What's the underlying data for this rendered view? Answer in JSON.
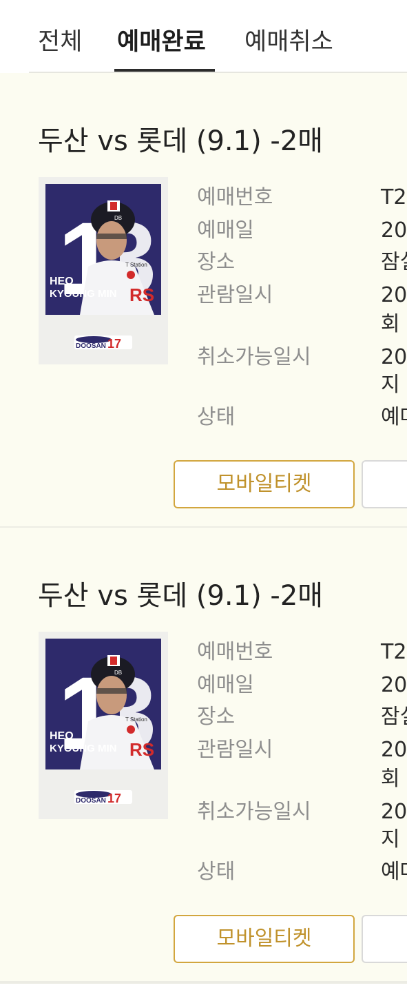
{
  "tabs": [
    {
      "label": "전체",
      "active": false
    },
    {
      "label": "예매완료",
      "active": true
    },
    {
      "label": "예매취소",
      "active": false
    }
  ],
  "info_labels": {
    "booking_no": "예매번호",
    "booking_date": "예매일",
    "venue": "장소",
    "game_datetime": "관람일시",
    "cancel_deadline": "취소가능일시",
    "status": "상태"
  },
  "reservations": [
    {
      "title": "두산 vs 롯데 (9.1) -2매",
      "poster": {
        "lines": [
          "HEO",
          "KYOUNG MIN"
        ],
        "number_text": "RS",
        "team_text": "DOOSAN"
      },
      "booking_no": "T2",
      "booking_date": "20",
      "venue": "잠실",
      "game_datetime_1": "20",
      "game_datetime_2": "회",
      "cancel_deadline_1": "20",
      "cancel_deadline_2": "지",
      "status": "예매",
      "mobile_ticket_label": "모바일티켓"
    },
    {
      "title": "두산 vs 롯데 (9.1) -2매",
      "poster": {
        "lines": [
          "HEO",
          "KYOUNG MIN"
        ],
        "number_text": "RS",
        "team_text": "DOOSAN"
      },
      "booking_no": "T2",
      "booking_date": "20",
      "venue": "잠실",
      "game_datetime_1": "20",
      "game_datetime_2": "회",
      "cancel_deadline_1": "20",
      "cancel_deadline_2": "지",
      "status": "예매",
      "mobile_ticket_label": "모바일티켓"
    }
  ],
  "colors": {
    "card_bg": "#fcfcf1",
    "accent_gold": "#d2a63e",
    "poster_navy": "#2e2a6b"
  }
}
